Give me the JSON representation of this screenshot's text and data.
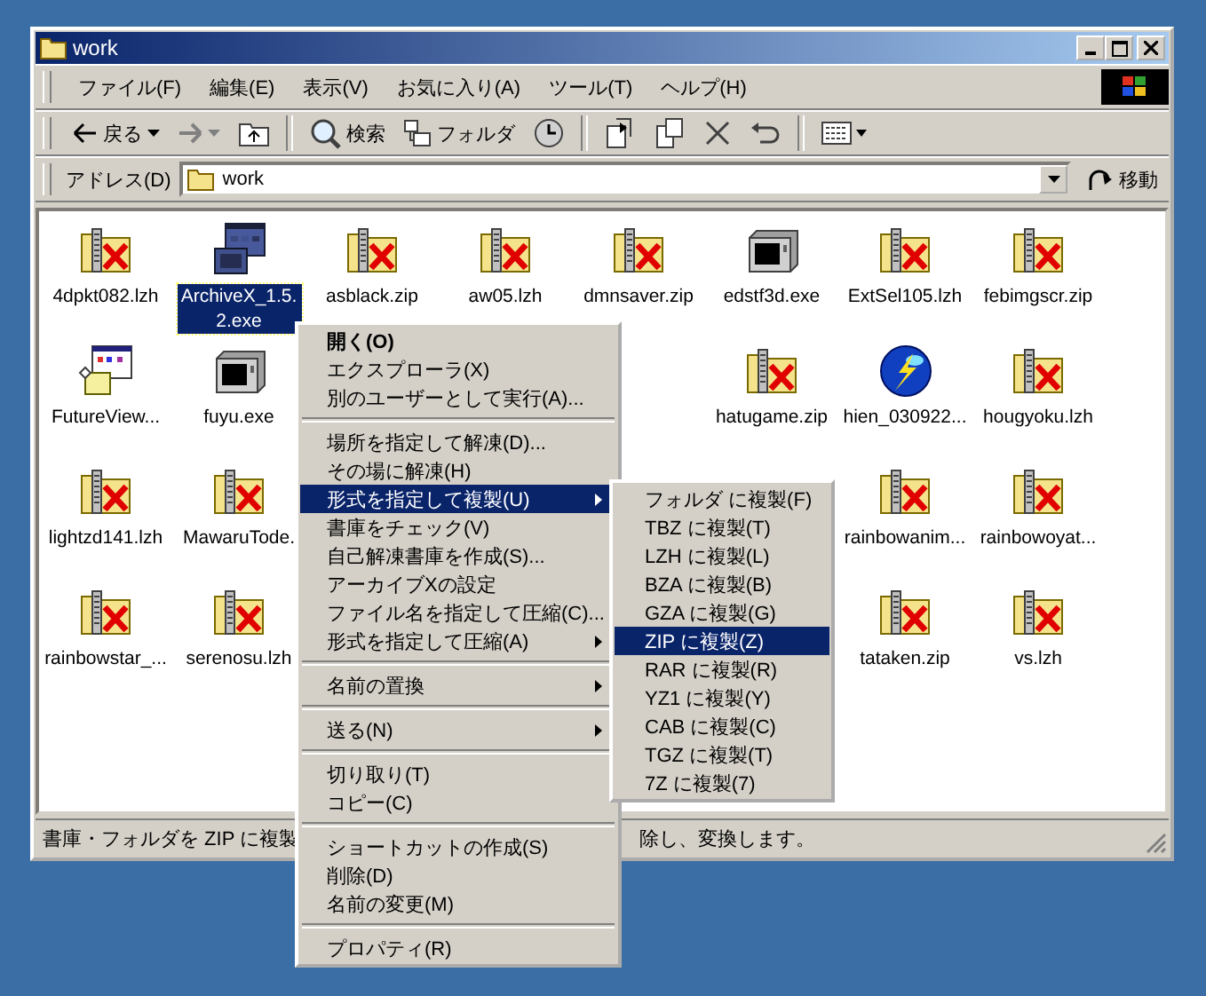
{
  "window": {
    "title": "work"
  },
  "menu_bar": [
    "ファイル(F)",
    "編集(E)",
    "表示(V)",
    "お気に入り(A)",
    "ツール(T)",
    "ヘルプ(H)"
  ],
  "toolbar": {
    "back": "戻る",
    "search": "検索",
    "folders": "フォルダ"
  },
  "address_bar": {
    "label": "アドレス(D)",
    "value": "work",
    "go": "移動"
  },
  "files": [
    {
      "left": [
        {
          "name": "4dpkt082.lzh",
          "kind": "archive",
          "selected": false
        },
        {
          "name": "ArchiveX_1.5.2.exe",
          "kind": "app",
          "selected": true
        },
        {
          "name": "asblack.zip",
          "kind": "archive",
          "selected": false
        },
        {
          "name": "aw05.lzh",
          "kind": "archive",
          "selected": false
        },
        {
          "name": "dmnsaver.zip",
          "kind": "archive",
          "selected": false
        },
        {
          "name": "edstf3d.exe",
          "kind": "device",
          "selected": false
        },
        {
          "name": "ExtSel105.lzh",
          "kind": "archive",
          "selected": false
        },
        {
          "name": "febimgscr.zip",
          "kind": "archive",
          "selected": false
        }
      ]
    },
    {
      "left": [
        {
          "name": "FutureView...",
          "kind": "setup",
          "selected": false
        },
        {
          "name": "fuyu.exe",
          "kind": "device",
          "selected": false
        }
      ],
      "right": [
        {
          "name": "hatugame.zip",
          "kind": "archive",
          "selected": false
        },
        {
          "name": "hien_030922...",
          "kind": "orb",
          "selected": false
        },
        {
          "name": "hougyoku.lzh",
          "kind": "archive",
          "selected": false
        }
      ]
    },
    {
      "left": [
        {
          "name": "lightzd141.lzh",
          "kind": "archive",
          "selected": false
        },
        {
          "name": "MawaruTode.",
          "kind": "archive",
          "selected": false
        }
      ],
      "right": [
        {
          "name": "rainbowanim...",
          "kind": "archive",
          "selected": false
        },
        {
          "name": "rainbowoyat...",
          "kind": "archive",
          "selected": false
        }
      ]
    },
    {
      "left": [
        {
          "name": "rainbowstar_...",
          "kind": "archive",
          "selected": false
        },
        {
          "name": "serenosu.lzh",
          "kind": "archive",
          "selected": false
        }
      ],
      "right": [
        {
          "name": "tataken.zip",
          "kind": "archive",
          "selected": false
        },
        {
          "name": "vs.lzh",
          "kind": "archive",
          "selected": false
        }
      ]
    }
  ],
  "context_menu": {
    "items": [
      {
        "kind": "item",
        "label": "開く(O)",
        "default": true,
        "selected": false,
        "submenu": false
      },
      {
        "kind": "item",
        "label": "エクスプローラ(X)",
        "default": false,
        "selected": false,
        "submenu": false
      },
      {
        "kind": "item",
        "label": "別のユーザーとして実行(A)...",
        "default": false,
        "selected": false,
        "submenu": false
      },
      {
        "kind": "separator"
      },
      {
        "kind": "item",
        "label": "場所を指定して解凍(D)...",
        "default": false,
        "selected": false,
        "submenu": false
      },
      {
        "kind": "item",
        "label": "その場に解凍(H)",
        "default": false,
        "selected": false,
        "submenu": false
      },
      {
        "kind": "item",
        "label": "形式を指定して複製(U)",
        "default": false,
        "selected": true,
        "submenu": true
      },
      {
        "kind": "item",
        "label": "書庫をチェック(V)",
        "default": false,
        "selected": false,
        "submenu": false
      },
      {
        "kind": "item",
        "label": "自己解凍書庫を作成(S)...",
        "default": false,
        "selected": false,
        "submenu": false
      },
      {
        "kind": "item",
        "label": "アーカイブXの設定",
        "default": false,
        "selected": false,
        "submenu": false
      },
      {
        "kind": "item",
        "label": "ファイル名を指定して圧縮(C)...",
        "default": false,
        "selected": false,
        "submenu": false
      },
      {
        "kind": "item",
        "label": "形式を指定して圧縮(A)",
        "default": false,
        "selected": false,
        "submenu": true
      },
      {
        "kind": "separator"
      },
      {
        "kind": "item",
        "label": "名前の置換",
        "default": false,
        "selected": false,
        "submenu": true
      },
      {
        "kind": "separator"
      },
      {
        "kind": "item",
        "label": "送る(N)",
        "default": false,
        "selected": false,
        "submenu": true
      },
      {
        "kind": "separator"
      },
      {
        "kind": "item",
        "label": "切り取り(T)",
        "default": false,
        "selected": false,
        "submenu": false
      },
      {
        "kind": "item",
        "label": "コピー(C)",
        "default": false,
        "selected": false,
        "submenu": false
      },
      {
        "kind": "separator"
      },
      {
        "kind": "item",
        "label": "ショートカットの作成(S)",
        "default": false,
        "selected": false,
        "submenu": false
      },
      {
        "kind": "item",
        "label": "削除(D)",
        "default": false,
        "selected": false,
        "submenu": false
      },
      {
        "kind": "item",
        "label": "名前の変更(M)",
        "default": false,
        "selected": false,
        "submenu": false
      },
      {
        "kind": "separator"
      },
      {
        "kind": "item",
        "label": "プロパティ(R)",
        "default": false,
        "selected": false,
        "submenu": false
      }
    ]
  },
  "submenu": {
    "items": [
      {
        "label": "フォルダ に複製(F)",
        "selected": false
      },
      {
        "label": "TBZ に複製(T)",
        "selected": false
      },
      {
        "label": "LZH に複製(L)",
        "selected": false
      },
      {
        "label": "BZA に複製(B)",
        "selected": false
      },
      {
        "label": "GZA に複製(G)",
        "selected": false
      },
      {
        "label": "ZIP に複製(Z)",
        "selected": true
      },
      {
        "label": "RAR に複製(R)",
        "selected": false
      },
      {
        "label": "YZ1 に複製(Y)",
        "selected": false
      },
      {
        "label": "CAB に複製(C)",
        "selected": false
      },
      {
        "label": "TGZ に複製(T)",
        "selected": false
      },
      {
        "label": "7Z に複製(7)",
        "selected": false
      }
    ]
  },
  "status_bar": {
    "text_left": "書庫・フォルダを ZIP に複製",
    "text_right": "除し、変換します。"
  }
}
